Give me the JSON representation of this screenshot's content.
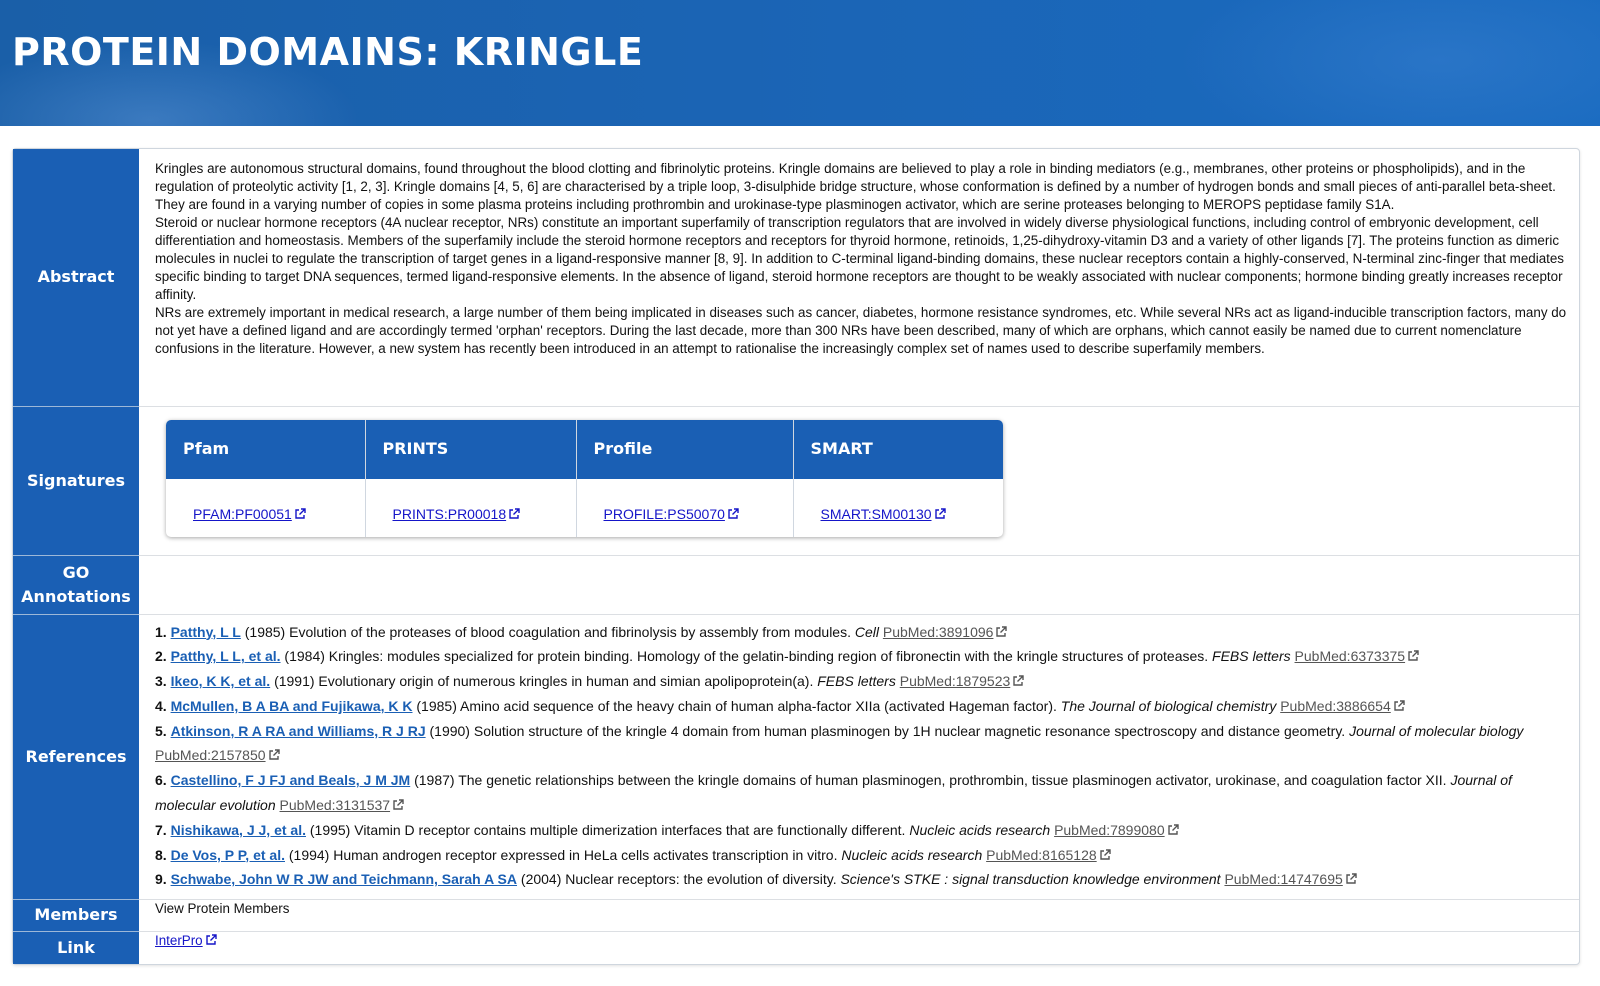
{
  "header": {
    "title": "PROTEIN DOMAINS: KRINGLE"
  },
  "rows": {
    "abstract_label": "Abstract",
    "signatures_label": "Signatures",
    "go_label": "GO Annotations",
    "references_label": "References",
    "members_label": "Members",
    "link_label": "Link"
  },
  "abstract": {
    "paragraphs": [
      "Kringles are autonomous structural domains, found throughout the blood clotting and fibrinolytic proteins. Kringle domains are believed to play a role in binding mediators (e.g., membranes, other proteins or phospholipids), and in the regulation of proteolytic activity [1, 2, 3]. Kringle domains [4, 5, 6] are characterised by a triple loop, 3-disulphide bridge structure, whose conformation is defined by a number of hydrogen bonds and small pieces of anti-parallel beta-sheet. They are found in a varying number of copies in some plasma proteins including prothrombin and urokinase-type plasminogen activator, which are serine proteases belonging to MEROPS peptidase family S1A.",
      "Steroid or nuclear hormone receptors (4A nuclear receptor, NRs) constitute an important superfamily of transcription regulators that are involved in widely diverse physiological functions, including control of embryonic development, cell differentiation and homeostasis. Members of the superfamily include the steroid hormone receptors and receptors for thyroid hormone, retinoids, 1,25-dihydroxy-vitamin D3 and a variety of other ligands [7]. The proteins function as dimeric molecules in nuclei to regulate the transcription of target genes in a ligand-responsive manner [8, 9]. In addition to C-terminal ligand-binding domains, these nuclear receptors contain a highly-conserved, N-terminal zinc-finger that mediates specific binding to target DNA sequences, termed ligand-responsive elements. In the absence of ligand, steroid hormone receptors are thought to be weakly associated with nuclear components; hormone binding greatly increases receptor affinity.",
      "NRs are extremely important in medical research, a large number of them being implicated in diseases such as cancer, diabetes, hormone resistance syndromes, etc. While several NRs act as ligand-inducible transcription factors, many do not yet have a defined ligand and are accordingly termed 'orphan' receptors. During the last decade, more than 300 NRs have been described, many of which are orphans, which cannot easily be named due to current nomenclature confusions in the literature. However, a new system has recently been introduced in an attempt to rationalise the increasingly complex set of names used to describe superfamily members."
    ]
  },
  "signatures": [
    {
      "db": "Pfam",
      "id": "PFAM:PF00051"
    },
    {
      "db": "PRINTS",
      "id": "PRINTS:PR00018"
    },
    {
      "db": "Profile",
      "id": "PROFILE:PS50070"
    },
    {
      "db": "SMART",
      "id": "SMART:SM00130"
    }
  ],
  "go_annotations": "",
  "references": [
    {
      "num": "1.",
      "authors": "Patthy, L L",
      "year": "(1985)",
      "title": "Evolution of the proteases of blood coagulation and fibrinolysis by assembly from modules.",
      "journal": "Cell",
      "pubmed": "PubMed:3891096"
    },
    {
      "num": "2.",
      "authors": "Patthy, L L, et al.",
      "year": "(1984)",
      "title": "Kringles: modules specialized for protein binding. Homology of the gelatin-binding region of fibronectin with the kringle structures of proteases.",
      "journal": "FEBS letters",
      "pubmed": "PubMed:6373375"
    },
    {
      "num": "3.",
      "authors": "Ikeo, K K, et al.",
      "year": "(1991)",
      "title": "Evolutionary origin of numerous kringles in human and simian apolipoprotein(a).",
      "journal": "FEBS letters",
      "pubmed": "PubMed:1879523"
    },
    {
      "num": "4.",
      "authors": "McMullen, B A BA and Fujikawa, K K",
      "year": "(1985)",
      "title": "Amino acid sequence of the heavy chain of human alpha-factor XIIa (activated Hageman factor).",
      "journal": "The Journal of biological chemistry",
      "pubmed": "PubMed:3886654"
    },
    {
      "num": "5.",
      "authors": "Atkinson, R A RA and Williams, R J RJ",
      "year": "(1990)",
      "title": "Solution structure of the kringle 4 domain from human plasminogen by 1H nuclear magnetic resonance spectroscopy and distance geometry.",
      "journal": "Journal of molecular biology",
      "pubmed": "PubMed:2157850"
    },
    {
      "num": "6.",
      "authors": "Castellino, F J FJ and Beals, J M JM",
      "year": "(1987)",
      "title": "The genetic relationships between the kringle domains of human plasminogen, prothrombin, tissue plasminogen activator, urokinase, and coagulation factor XII.",
      "journal": "Journal of molecular evolution",
      "pubmed": "PubMed:3131537"
    },
    {
      "num": "7.",
      "authors": "Nishikawa, J J, et al.",
      "year": "(1995)",
      "title": "Vitamin D receptor contains multiple dimerization interfaces that are functionally different.",
      "journal": "Nucleic acids research",
      "pubmed": "PubMed:7899080"
    },
    {
      "num": "8.",
      "authors": "De Vos, P P, et al.",
      "year": "(1994)",
      "title": "Human androgen receptor expressed in HeLa cells activates transcription in vitro.",
      "journal": "Nucleic acids research",
      "pubmed": "PubMed:8165128"
    },
    {
      "num": "9.",
      "authors": "Schwabe, John W R JW and Teichmann, Sarah A SA",
      "year": "(2004)",
      "title": "Nuclear receptors: the evolution of diversity.",
      "journal": "Science's STKE : signal transduction knowledge environment",
      "pubmed": "PubMed:14747695"
    }
  ],
  "members": {
    "text": "View Protein Members"
  },
  "link": {
    "text": "InterPro"
  },
  "colors": {
    "primary": "#1a5fb4",
    "link": "#1515c8",
    "pubmed_link": "#555555"
  }
}
